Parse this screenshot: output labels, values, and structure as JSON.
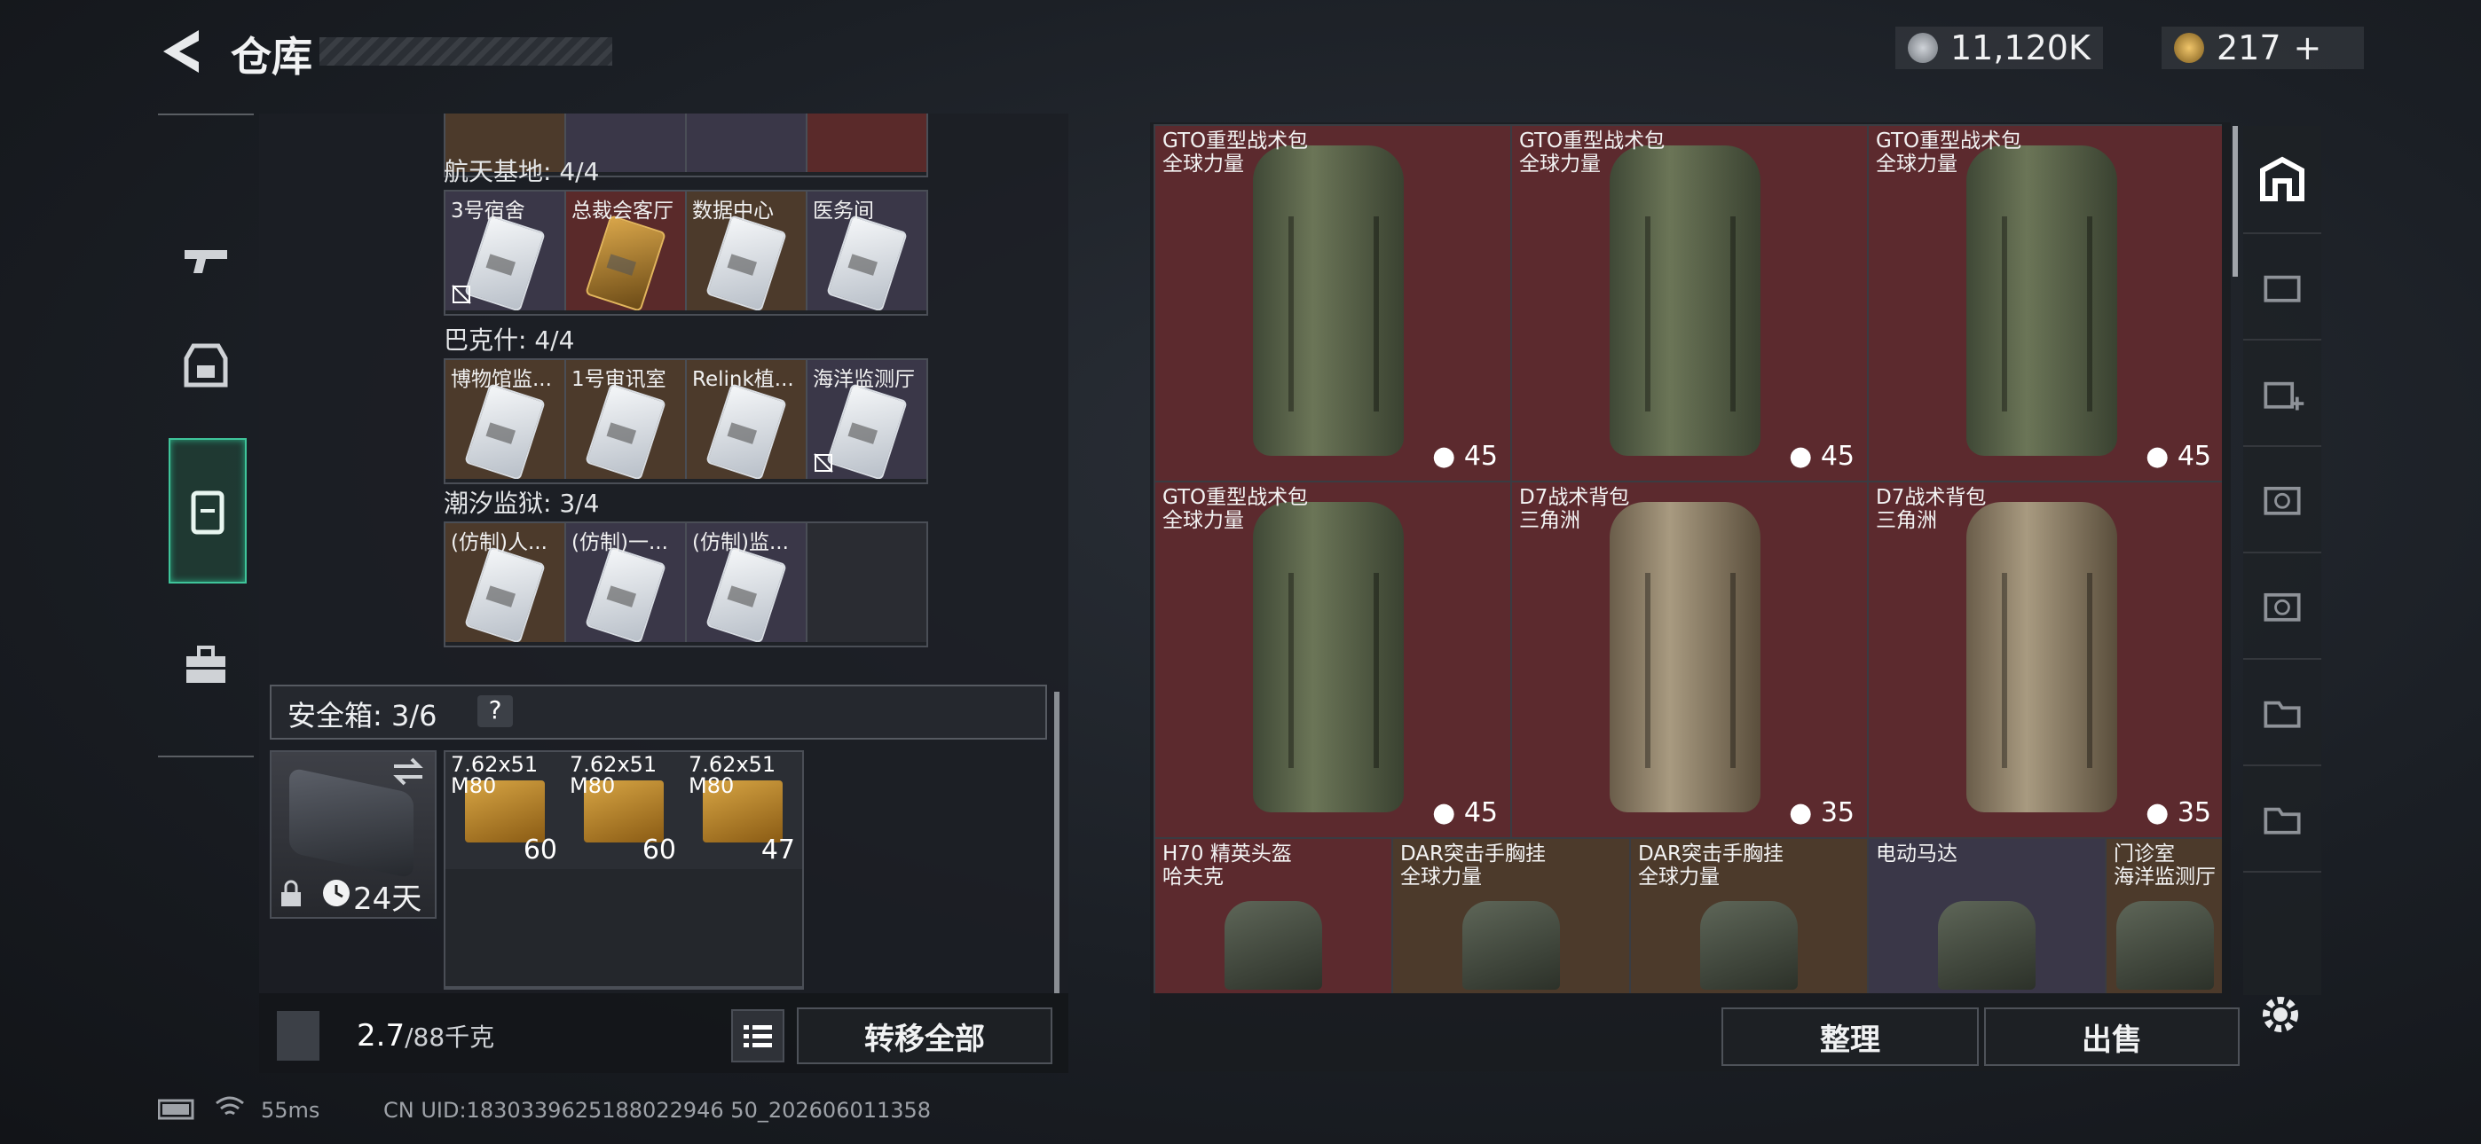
{
  "header": {
    "title": "仓库"
  },
  "currency": {
    "coins": "11,120K",
    "premium": "217",
    "add": "+"
  },
  "left_nav": [
    "weapons",
    "armor",
    "backpack",
    "toolbox"
  ],
  "key_groups": [
    {
      "label": "航天基地: 4/4",
      "slots": [
        {
          "name": "3号宿舍",
          "bg": "lav",
          "card": "white",
          "no_sell": true
        },
        {
          "name": "总裁会客厅",
          "bg": "red",
          "card": "gold",
          "no_sell": false
        },
        {
          "name": "数据中心",
          "bg": "brown",
          "card": "white",
          "no_sell": false
        },
        {
          "name": "医务间",
          "bg": "lav",
          "card": "white",
          "no_sell": false
        }
      ]
    },
    {
      "label": "巴克什: 4/4",
      "slots": [
        {
          "name": "博物馆监...",
          "bg": "brown",
          "card": "white",
          "no_sell": false
        },
        {
          "name": "1号审讯室",
          "bg": "brown",
          "card": "white",
          "no_sell": false
        },
        {
          "name": "Relink植...",
          "bg": "brown",
          "card": "white",
          "no_sell": false
        },
        {
          "name": "海洋监测厅",
          "bg": "lav",
          "card": "white",
          "no_sell": true
        }
      ]
    },
    {
      "label": "潮汐监狱: 3/4",
      "slots": [
        {
          "name": "(仿制)人...",
          "bg": "brown",
          "card": "white",
          "no_sell": false
        },
        {
          "name": "(仿制)一...",
          "bg": "lav",
          "card": "white",
          "no_sell": false
        },
        {
          "name": "(仿制)监...",
          "bg": "lav",
          "card": "white",
          "no_sell": false
        },
        {
          "name": "",
          "bg": "dark",
          "card": "none",
          "no_sell": false
        }
      ]
    }
  ],
  "safebox": {
    "label": "安全箱: 3/6",
    "help": "?",
    "days": "24天"
  },
  "ammo": [
    {
      "name": "7.62x51\nM80",
      "count": "60"
    },
    {
      "name": "7.62x51\nM80",
      "count": "60"
    },
    {
      "name": "7.62x51\nM80",
      "count": "47"
    }
  ],
  "weight": {
    "current": "2.7",
    "max": "/88千克"
  },
  "buttons": {
    "transfer_all": "转移全部",
    "organize": "整理",
    "sell": "出售"
  },
  "stash_items": [
    {
      "name": "GTO重型战术包",
      "brand": "全球力量",
      "capacity": "45",
      "color": "green"
    },
    {
      "name": "GTO重型战术包",
      "brand": "全球力量",
      "capacity": "45",
      "color": "green"
    },
    {
      "name": "GTO重型战术包",
      "brand": "全球力量",
      "capacity": "45",
      "color": "green"
    },
    {
      "name": "GTO重型战术包",
      "brand": "全球力量",
      "capacity": "45",
      "color": "green"
    },
    {
      "name": "D7战术背包",
      "brand": "三角洲",
      "capacity": "35",
      "color": "tan"
    },
    {
      "name": "D7战术背包",
      "brand": "三角洲",
      "capacity": "35",
      "color": "tan"
    }
  ],
  "lower_items": [
    {
      "name": "H70 精英头盔",
      "brand": "哈夫克",
      "bg": "#5c2a2e"
    },
    {
      "name": "DAR突击手胸挂",
      "brand": "全球力量",
      "bg": "#4c3a2b"
    },
    {
      "name": "DAR突击手胸挂",
      "brand": "全球力量",
      "bg": "#4c3a2b"
    },
    {
      "name": "电动马达",
      "brand": "",
      "bg": "#3a3748"
    },
    {
      "name": "门诊室",
      "brand": "海洋监测厅",
      "bg": "#4c3a2b"
    }
  ],
  "status": {
    "ping": "55ms",
    "uid": "CN UID:1830339625188022946 50_202606011358"
  },
  "colors": {
    "accent": "#3fc49a",
    "rare_red": "#5c2a2e",
    "epic_lav": "#3a3748",
    "gold": "#d7a544"
  }
}
